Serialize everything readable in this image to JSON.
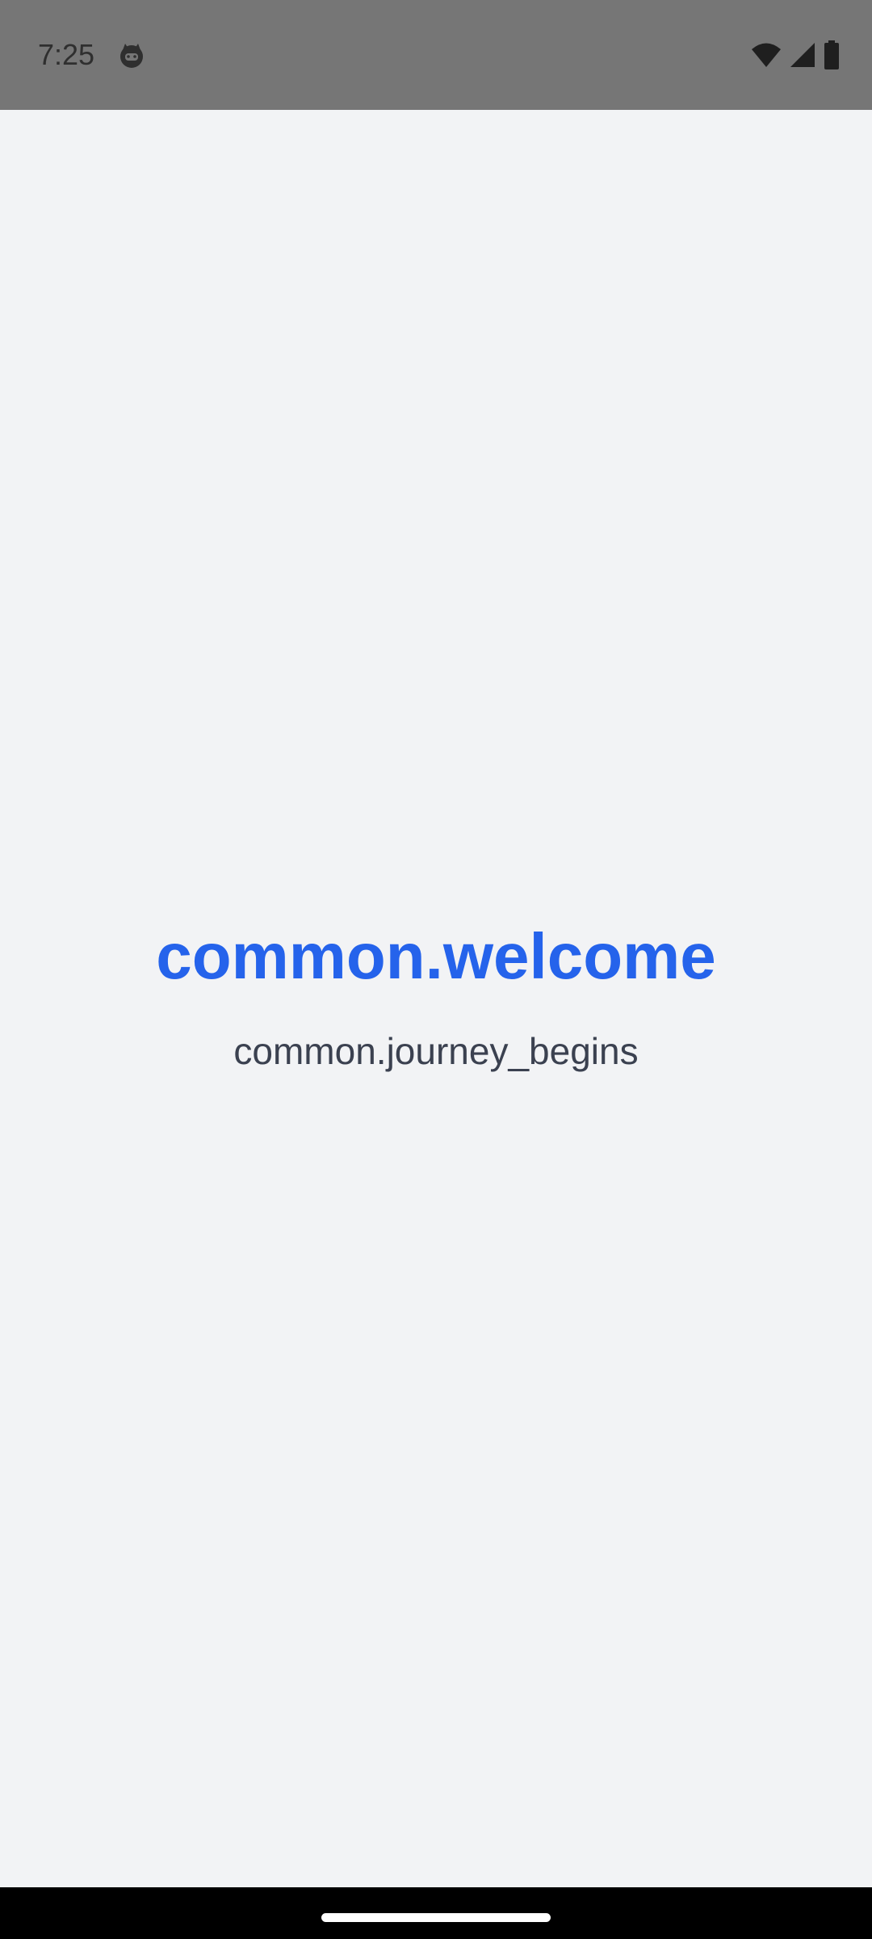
{
  "status_bar": {
    "time": "7:25",
    "app_icon": "cat-face-icon",
    "icons": [
      "wifi-icon",
      "cellular-signal-icon",
      "battery-icon"
    ]
  },
  "main": {
    "title": "common.welcome",
    "subtitle": "common.journey_begins"
  },
  "colors": {
    "status_bar_bg": "#767676",
    "background": "#f2f3f5",
    "title": "#2563eb",
    "subtitle": "#3b4150",
    "nav_bar_bg": "#000000"
  }
}
